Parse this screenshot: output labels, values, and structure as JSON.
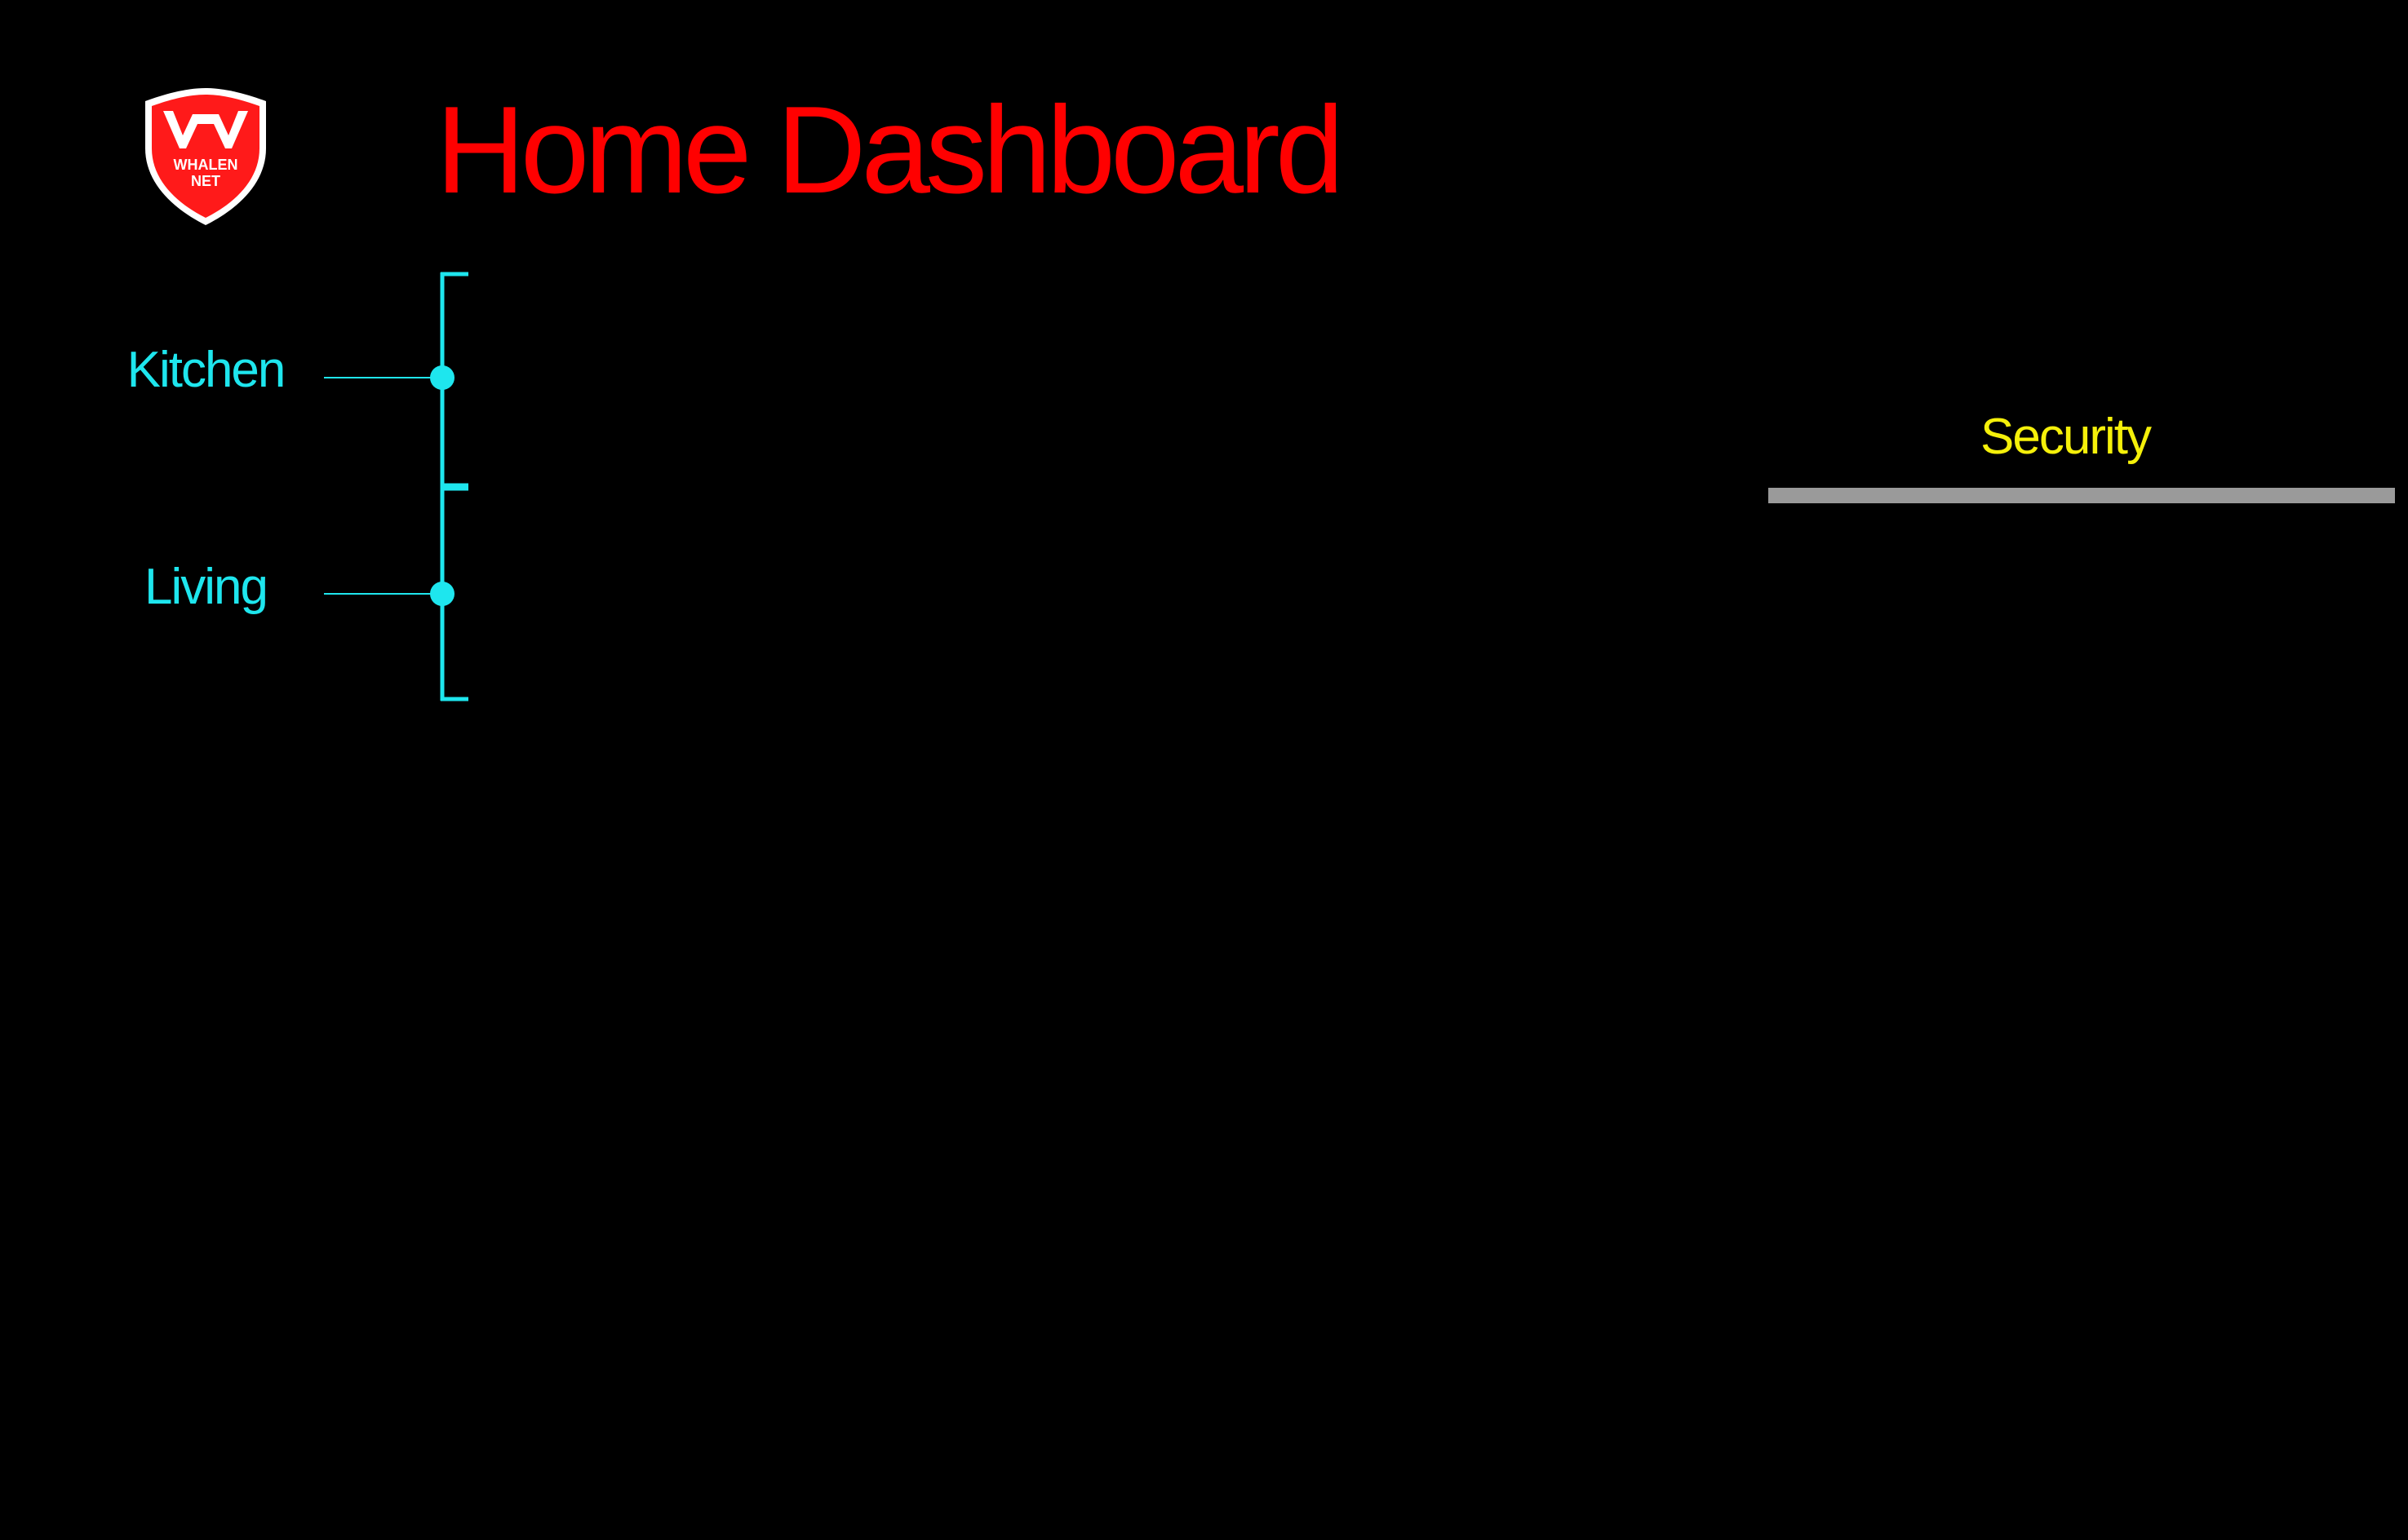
{
  "header": {
    "title": "Home Dashboard",
    "logo": {
      "icon": "whalennet-shield-logo",
      "text_line1": "WHALEN",
      "text_line2": "NET",
      "colors": {
        "fill": "#ff1a1a",
        "outline": "#ffffff"
      }
    }
  },
  "rooms": {
    "items": [
      {
        "label": "Kitchen",
        "icon": "node-dot-icon"
      },
      {
        "label": "Living",
        "icon": "node-dot-icon"
      }
    ],
    "color": "#1ee6ee"
  },
  "security": {
    "label": "Security",
    "label_color": "#f5f00a",
    "bar_color": "#9a9a9a"
  },
  "theme": {
    "background": "#000000",
    "title_color": "#ff0000"
  }
}
